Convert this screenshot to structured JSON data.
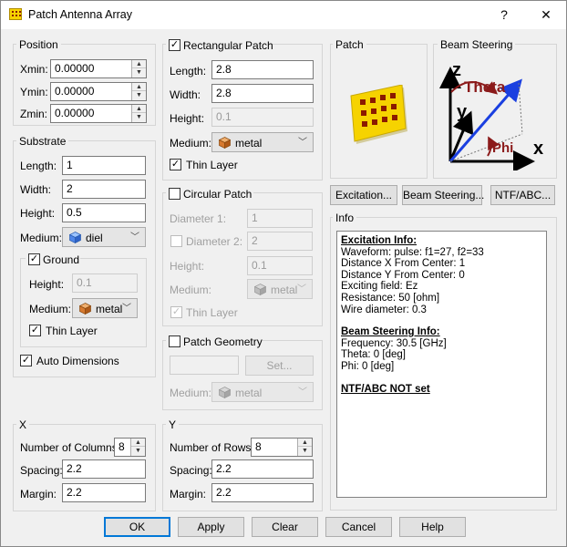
{
  "window": {
    "title": "Patch Antenna Array",
    "help_label": "?",
    "close_label": "✕"
  },
  "position": {
    "title": "Position",
    "fields": [
      {
        "label": "Xmin:",
        "value": "0.00000"
      },
      {
        "label": "Ymin:",
        "value": "0.00000"
      },
      {
        "label": "Zmin:",
        "value": "0.00000"
      }
    ]
  },
  "substrate": {
    "title": "Substrate",
    "length_label": "Length:",
    "length": "1",
    "width_label": "Width:",
    "width": "2",
    "height_label": "Height:",
    "height": "0.5",
    "medium_label": "Medium:",
    "medium": "diel",
    "ground": {
      "label": "Ground",
      "checked": true,
      "height_label": "Height:",
      "height": "0.1",
      "medium_label": "Medium:",
      "medium": "metal",
      "thin_layer_label": "Thin Layer"
    },
    "auto_dimensions_label": "Auto Dimensions"
  },
  "rect_patch": {
    "label": "Rectangular Patch",
    "length_label": "Length:",
    "length": "2.8",
    "width_label": "Width:",
    "width": "2.8",
    "height_label": "Height:",
    "height": "0.1",
    "medium_label": "Medium:",
    "medium": "metal",
    "thin_layer_label": "Thin Layer"
  },
  "circ_patch": {
    "label": "Circular Patch",
    "d1_label": "Diameter 1:",
    "d1": "1",
    "d2_label": "Diameter 2:",
    "d2": "2",
    "height_label": "Height:",
    "height": "0.1",
    "medium_label": "Medium:",
    "medium": "metal",
    "thin_layer_label": "Thin Layer"
  },
  "patch_geometry": {
    "label": "Patch Geometry",
    "set_label": "Set...",
    "medium_label": "Medium:",
    "medium": "metal"
  },
  "patch_preview": {
    "title": "Patch"
  },
  "beam_preview": {
    "title": "Beam Steering",
    "z": "z",
    "y": "y",
    "x": "x",
    "theta": "Theta",
    "phi": "Phi"
  },
  "action_buttons": {
    "excitation": "Excitation...",
    "beam": "Beam Steering...",
    "ntf": "NTF/ABC..."
  },
  "info": {
    "title": "Info",
    "excitation_heading": "Excitation Info:",
    "excitation_lines": [
      "Waveform: pulse: f1=27, f2=33",
      "Distance X From Center: 1",
      "Distance Y From Center: 0",
      "Exciting field: Ez",
      "Resistance: 50 [ohm]",
      "Wire diameter: 0.3"
    ],
    "beam_heading": "Beam Steering Info:",
    "beam_lines": [
      "Frequency: 30.5 [GHz]",
      "Theta: 0 [deg]",
      "Phi: 0 [deg]"
    ],
    "ntf_heading": "NTF/ABC NOT set"
  },
  "x_group": {
    "title": "X",
    "cols_label": "Number of Columns:",
    "cols": "8",
    "spacing_label": "Spacing:",
    "spacing": "2.2",
    "margin_label": "Margin:",
    "margin": "2.2"
  },
  "y_group": {
    "title": "Y",
    "rows_label": "Number of Rows:",
    "rows": "8",
    "spacing_label": "Spacing:",
    "spacing": "2.2",
    "margin_label": "Margin:",
    "margin": "2.2"
  },
  "footer": {
    "ok": "OK",
    "apply": "Apply",
    "clear": "Clear",
    "cancel": "Cancel",
    "help": "Help"
  },
  "colors": {
    "accent": "#0078d7",
    "patch_yellow": "#f6d300",
    "patch_hole": "#8b1a00",
    "theta_arrow": "#8b1a1a",
    "beam_arrow": "#1a3fe0"
  },
  "icons": {
    "app": "patch-array-icon",
    "diel": "blue-cube-icon",
    "metal": "orange-cube-icon"
  },
  "checks": {
    "rect_patch": true,
    "rect_thin_layer": true,
    "ground": true,
    "ground_thin_layer": true,
    "auto_dimensions": true,
    "circ_patch": false,
    "circ_d2": false,
    "circ_thin_layer": true,
    "patch_geometry": false
  }
}
